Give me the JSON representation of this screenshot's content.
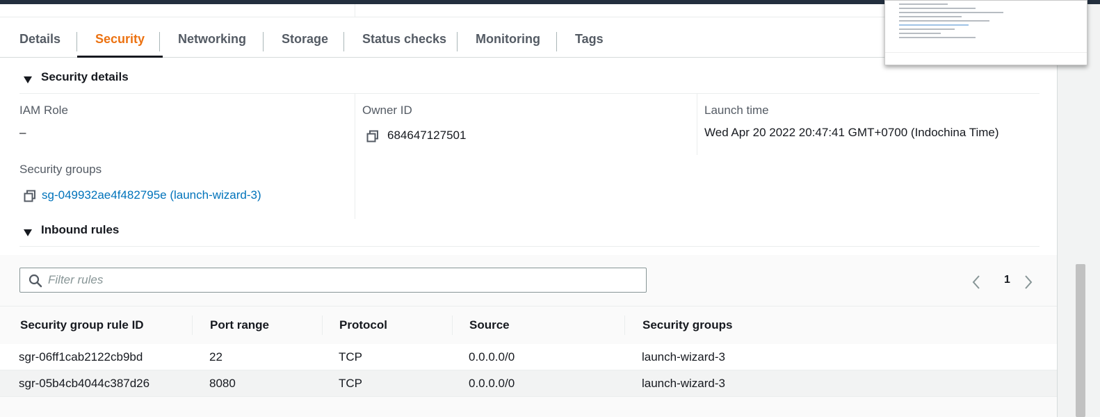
{
  "tabs": [
    "Details",
    "Security",
    "Networking",
    "Storage",
    "Status checks",
    "Monitoring",
    "Tags"
  ],
  "active_tab": "Security",
  "security_details": {
    "section_title": "Security details",
    "iam_role_label": "IAM Role",
    "iam_role_value": "–",
    "owner_id_label": "Owner ID",
    "owner_id_value": "684647127501",
    "launch_time_label": "Launch time",
    "launch_time_value": "Wed Apr 20 2022 20:47:41 GMT+0700 (Indochina Time)",
    "security_groups_label": "Security groups",
    "security_group_link": "sg-049932ae4f482795e (launch-wizard-3)"
  },
  "inbound_rules": {
    "section_title": "Inbound rules",
    "filter_placeholder": "Filter rules",
    "page": "1",
    "columns": [
      "Security group rule ID",
      "Port range",
      "Protocol",
      "Source",
      "Security groups"
    ],
    "rows": [
      [
        "sgr-06ff1cab2122cb9bd",
        "22",
        "TCP",
        "0.0.0.0/0",
        "launch-wizard-3"
      ],
      [
        "sgr-05b4cb4044c387d26",
        "8080",
        "TCP",
        "0.0.0.0/0",
        "launch-wizard-3"
      ]
    ]
  },
  "colors": {
    "accent": "#ec7211",
    "link": "#0073bb",
    "topbar": "#232f3e"
  },
  "icons": [
    "copy-icon",
    "search-icon",
    "chevron-left-icon",
    "chevron-right-icon",
    "caret-down-icon"
  ]
}
